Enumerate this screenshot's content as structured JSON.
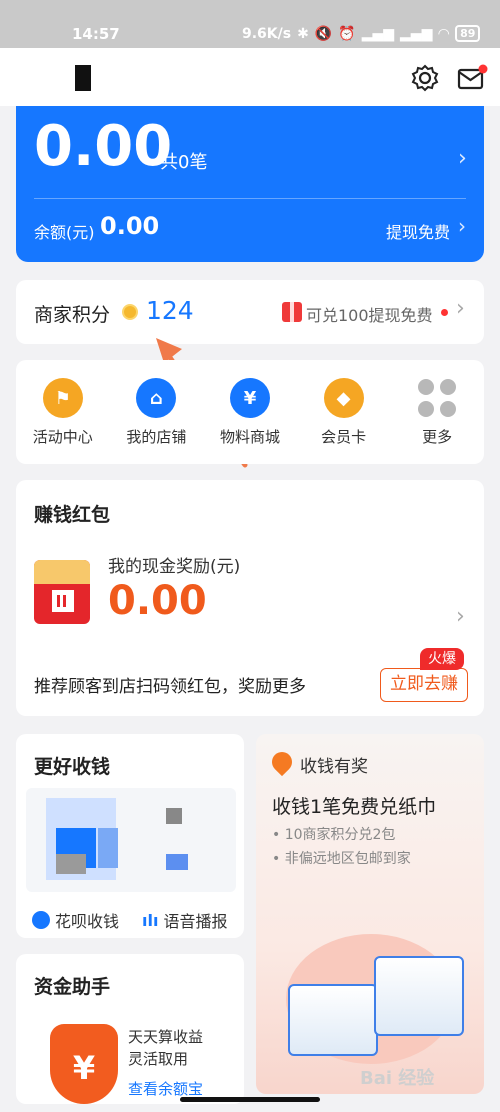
{
  "status_bar": {
    "time": "14:57",
    "net_speed": "9.6K/s",
    "battery": "89"
  },
  "header": {
    "settings_icon": "gear-icon",
    "message_icon": "mail-icon"
  },
  "income_card": {
    "amount": "0.00",
    "count": "共0笔",
    "balance_label": "余额(元)",
    "balance_value": "0.00",
    "withdraw_text": "提现免费"
  },
  "points": {
    "label": "商家积分",
    "value": "124",
    "promo": "可兑100提现免费"
  },
  "quick_menu": [
    {
      "label": "活动中心",
      "icon": "flag-icon",
      "color": "#f5a623"
    },
    {
      "label": "我的店铺",
      "icon": "store-icon",
      "color": "#1677ff"
    },
    {
      "label": "物料商城",
      "icon": "cart-icon",
      "color": "#1677ff"
    },
    {
      "label": "会员卡",
      "icon": "diamond-icon",
      "color": "#f5a623"
    },
    {
      "label": "更多",
      "icon": "more-icon",
      "color": "#b8b8b8"
    }
  ],
  "red_packet": {
    "title": "赚钱红包",
    "reward_label": "我的现金奖励(元)",
    "reward_value": "0.00",
    "recommend_text": "推荐顾客到店扫码领红包，奖励更多",
    "hot_badge": "火爆",
    "earn_button": "立即去赚"
  },
  "better_receive": {
    "title": "更好收钱",
    "feature1": "花呗收钱",
    "feature2": "语音播报"
  },
  "promo": {
    "header": "收钱有奖",
    "title": "收钱1笔免费兑纸巾",
    "line1": "• 10商家积分兑2包",
    "line2": "• 非偏远地区包邮到家"
  },
  "fund_helper": {
    "title": "资金助手",
    "line1": "天天算收益",
    "line2": "灵活取用",
    "link": "查看余额宝"
  },
  "watermark": "Bai 经验"
}
